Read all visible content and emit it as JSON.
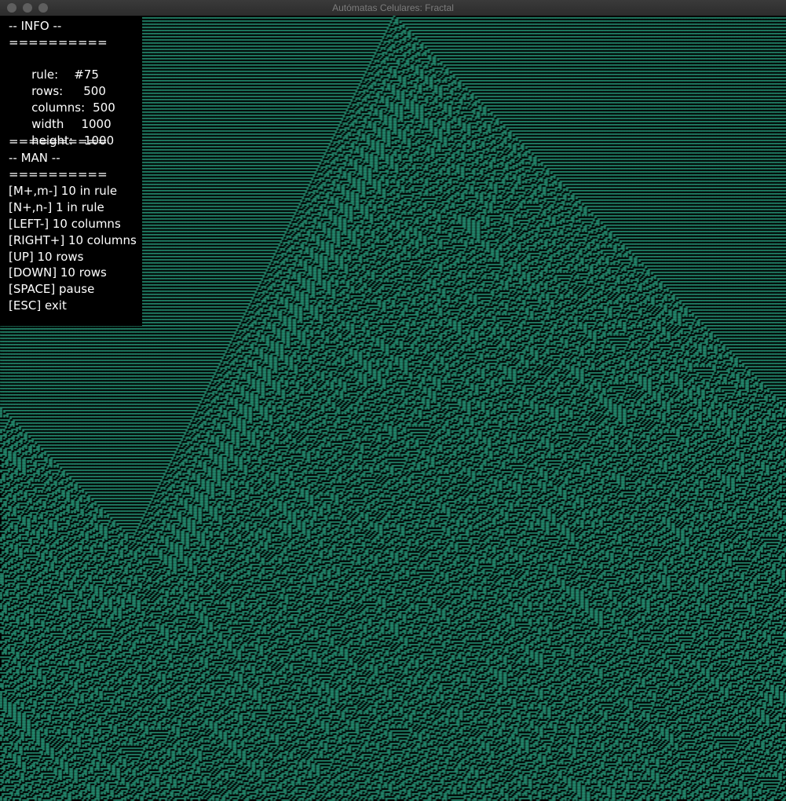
{
  "window": {
    "title": "Autómatas Celulares: Fractal"
  },
  "colors": {
    "cell_alive": "#2a9d7e",
    "cell_dead": "#000000",
    "background": "#000000",
    "text": "#ffffff"
  },
  "info": {
    "header": "-- INFO --",
    "sep1": "==========",
    "rule_label": "rule:",
    "rule_value": "#75",
    "rows_label": "rows:",
    "rows_value": "500",
    "columns_label": "columns:",
    "columns_value": "500",
    "width_label": "width",
    "width_value": "1000",
    "height_label": "height:",
    "height_value": "1000",
    "sep2": "==========",
    "man_header": "-- MAN --",
    "sep3": "==========",
    "commands": [
      "[M+,m-] 10 in rule",
      "[N+,n-] 1 in rule",
      "[LEFT-] 10 columns",
      "[RIGHT+] 10 columns",
      "[UP] 10 rows",
      "[DOWN] 10 rows",
      "[SPACE] pause",
      "[ESC] exit"
    ]
  }
}
